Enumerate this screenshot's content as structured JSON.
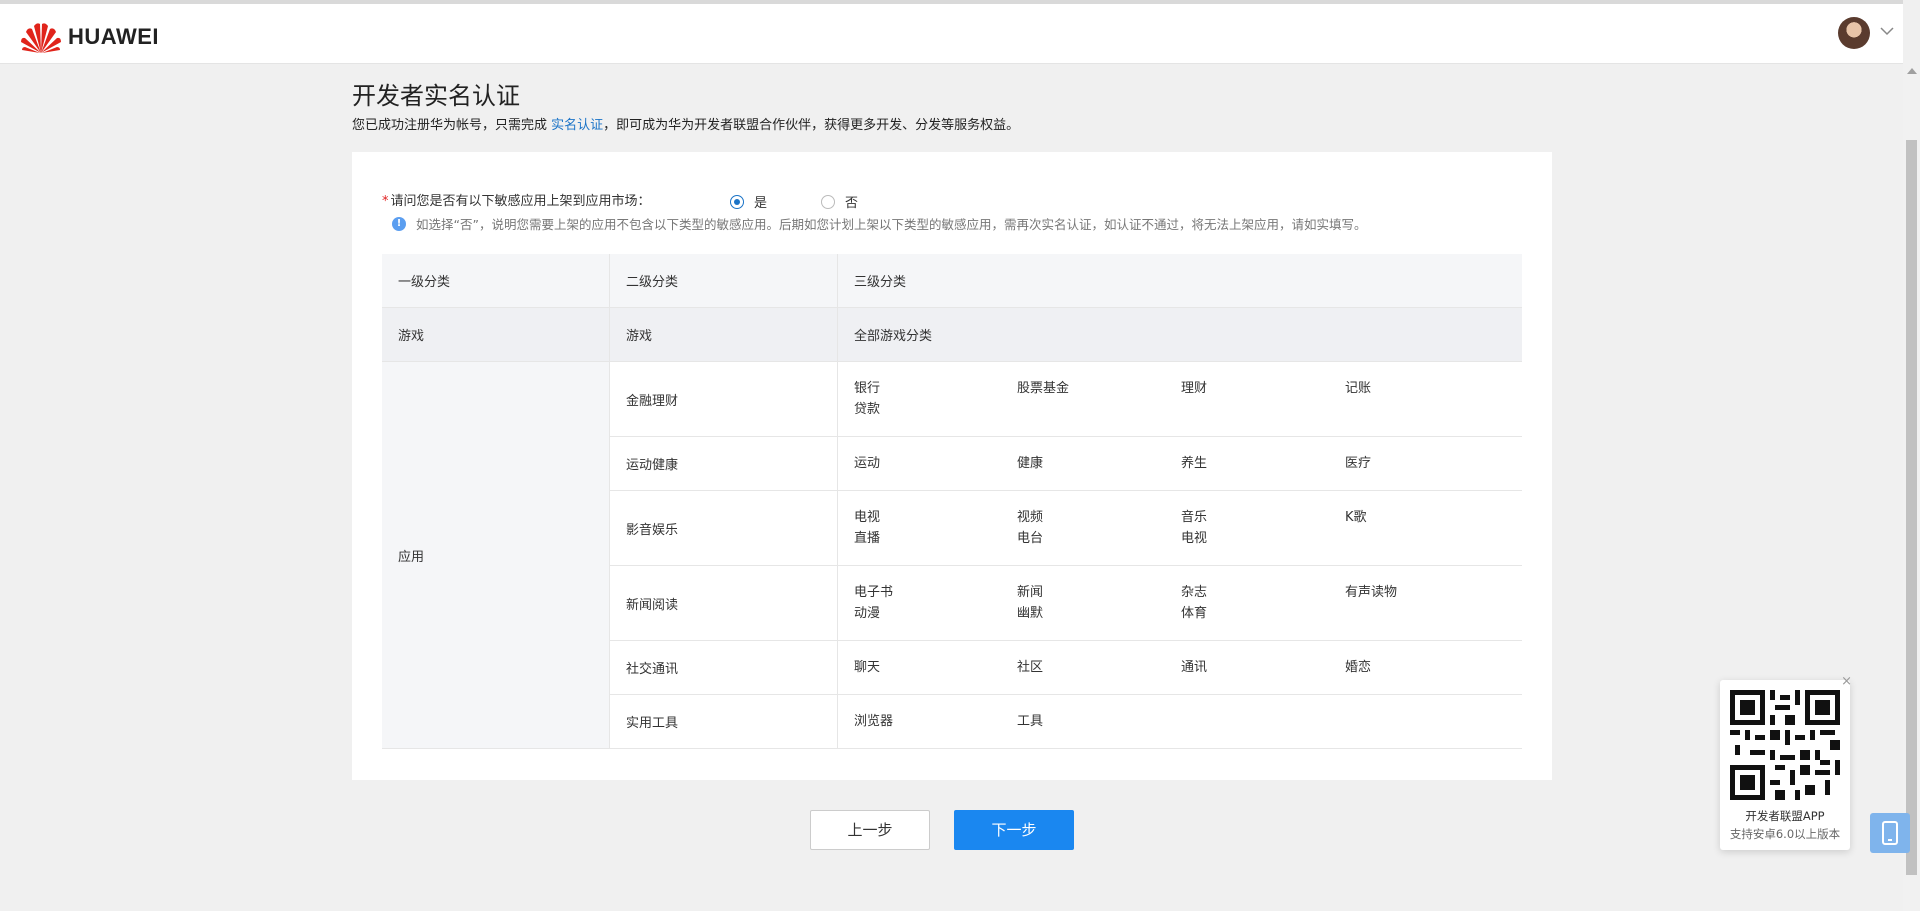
{
  "header": {
    "logo_text": "HUAWEI"
  },
  "page": {
    "title": "开发者实名认证",
    "intro_before": "您已成功注册华为帐号，只需完成 ",
    "intro_link": "实名认证",
    "intro_after": "，即可成为华为开发者联盟合作伙伴，获得更多开发、分发等服务权益。"
  },
  "question": {
    "required_mark": "*",
    "label": "请问您是否有以下敏感应用上架到应用市场：",
    "options": [
      "是",
      "否"
    ],
    "selected": "是",
    "hint": "如选择“否”，说明您需要上架的应用不包含以下类型的敏感应用。后期如您计划上架以下类型的敏感应用，需再次实名认证，如认证不通过，将无法上架应用，请如实填写。"
  },
  "table": {
    "headers": [
      "一级分类",
      "二级分类",
      "三级分类"
    ],
    "game_row": {
      "level1": "游戏",
      "level2": "游戏",
      "level3": "全部游戏分类"
    },
    "app_level1": "应用",
    "app_rows": [
      {
        "level2": "金融理财",
        "items": [
          "银行",
          "股票基金",
          "理财",
          "记账",
          "贷款"
        ]
      },
      {
        "level2": "运动健康",
        "items": [
          "运动",
          "健康",
          "养生",
          "医疗"
        ]
      },
      {
        "level2": "影音娱乐",
        "items": [
          "电视",
          "视频",
          "音乐",
          "K歌",
          "直播",
          "电台",
          "电视"
        ]
      },
      {
        "level2": "新闻阅读",
        "items": [
          "电子书",
          "新闻",
          "杂志",
          "有声读物",
          "动漫",
          "幽默",
          "体育"
        ]
      },
      {
        "level2": "社交通讯",
        "items": [
          "聊天",
          "社区",
          "通讯",
          "婚恋"
        ]
      },
      {
        "level2": "实用工具",
        "items": [
          "浏览器",
          "工具"
        ]
      }
    ]
  },
  "buttons": {
    "prev": "上一步",
    "next": "下一步"
  },
  "qr_popup": {
    "title": "开发者联盟APP",
    "subtitle": "支持安卓6.0以上版本",
    "close": "×"
  }
}
